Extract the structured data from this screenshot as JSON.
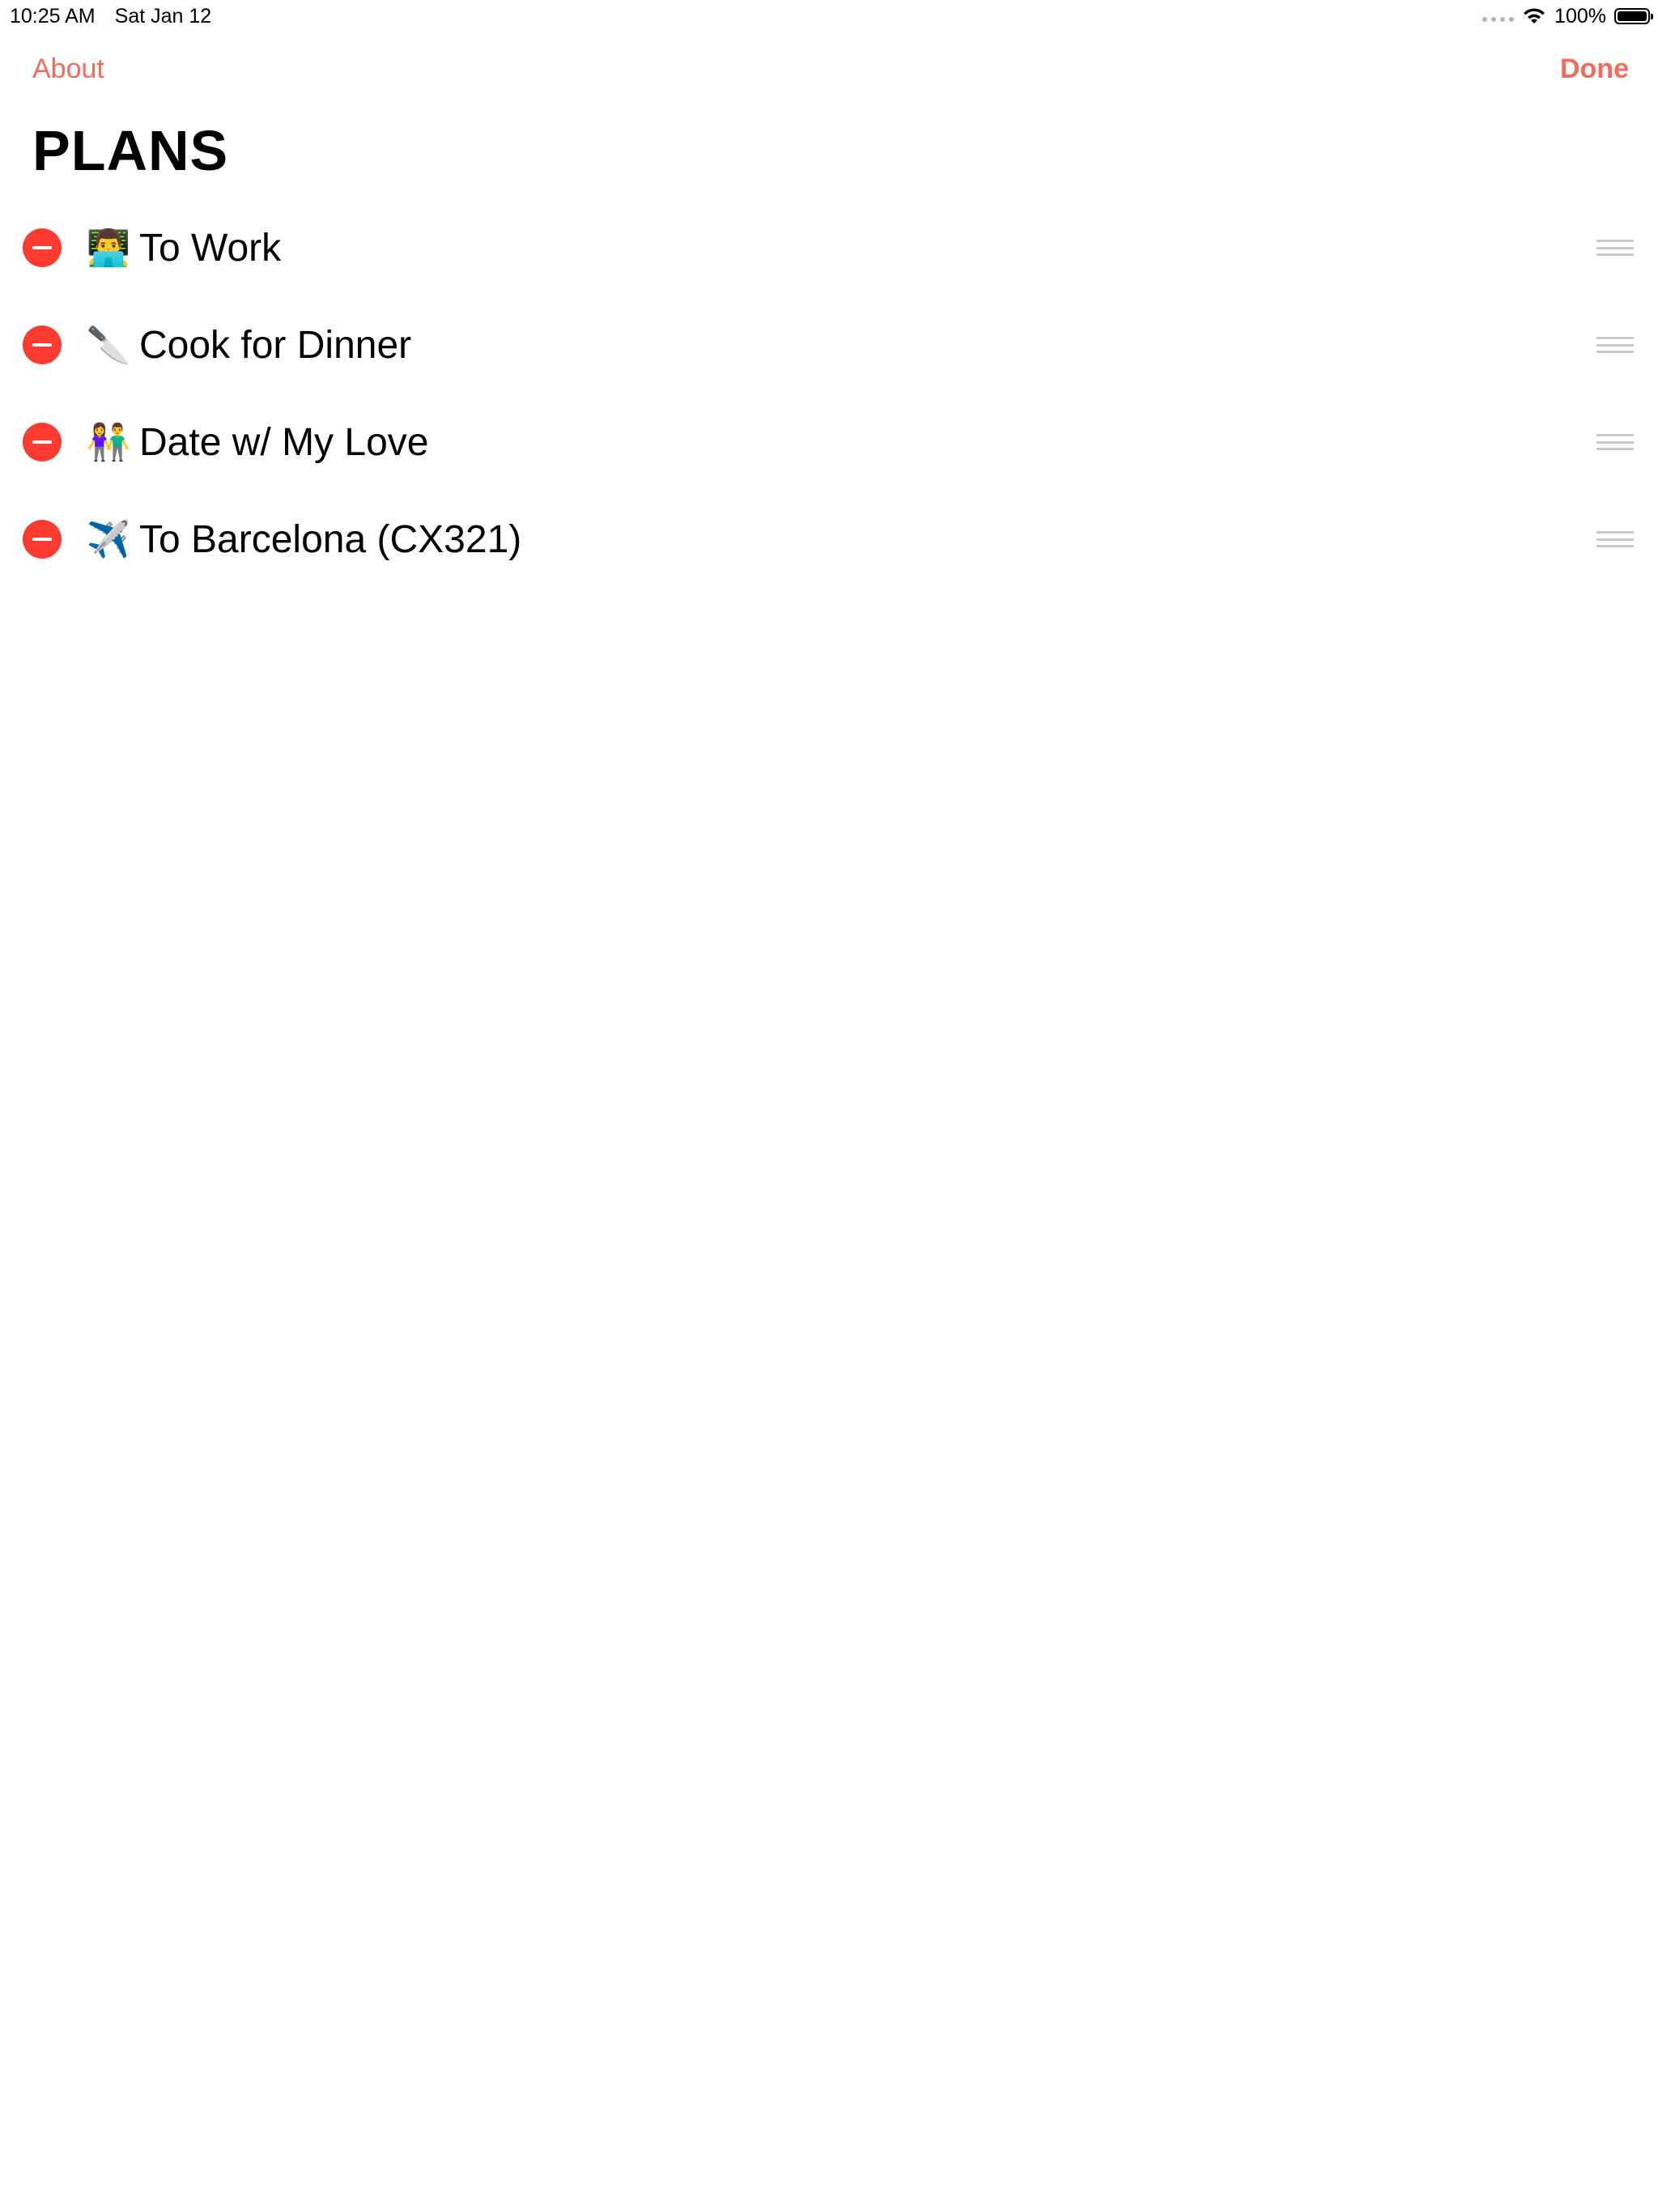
{
  "status_bar": {
    "time": "10:25 AM",
    "date": "Sat Jan 12",
    "battery_percent_label": "100%",
    "battery_level": 1.0,
    "icons": [
      "signal-dots-icon",
      "wifi-icon",
      "battery-icon"
    ]
  },
  "nav": {
    "about_label": "About",
    "done_label": "Done"
  },
  "page_title": "PLANS",
  "plans": [
    {
      "emoji": "👨‍💻",
      "label": "To Work"
    },
    {
      "emoji": "🔪",
      "label": "Cook for Dinner"
    },
    {
      "emoji": "👫",
      "label": "Date w/ My Love"
    },
    {
      "emoji": "✈️",
      "label": "To Barcelona (CX321)"
    }
  ],
  "colors": {
    "accent": "#f26b5b",
    "delete": "#fb3b30",
    "handle": "#c7c7cc"
  }
}
